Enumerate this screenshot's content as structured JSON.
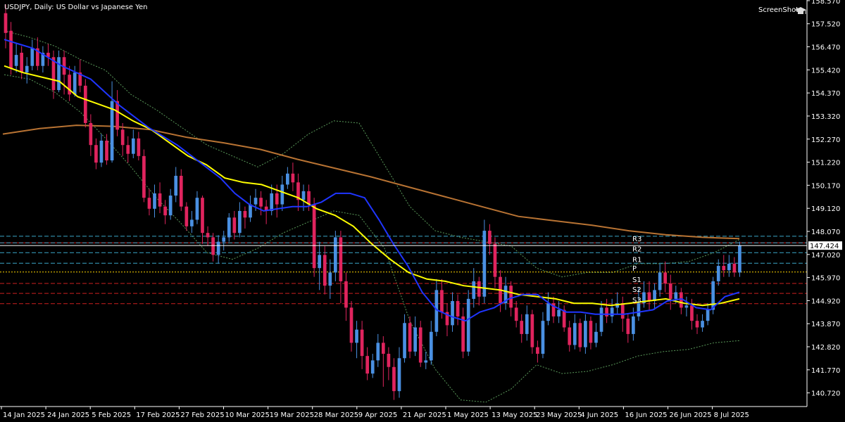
{
  "app": {
    "title": "USDJPY, Daily:  US Dollar vs Japanese Yen",
    "screenshot_label": "ScreenShot",
    "screenshot_icon": "graduation-cap-icon"
  },
  "colors": {
    "background": "#000000",
    "bull": "#4a90e2",
    "bear": "#e0245e",
    "ma_fast": "#1f35ff",
    "ma_slow": "#ffff00",
    "ma_long": "#b87333",
    "bands": "#5a9a5a",
    "axis": "#ffffff",
    "r_lines": "#3aa6c8",
    "p_line": "#ffd700",
    "s_lines": "#cc1f1f",
    "current": "#ffffff"
  },
  "chart_data": {
    "type": "candlestick",
    "symbol": "USDJPY",
    "timeframe": "Daily",
    "ylim": [
      140.1,
      158.6
    ],
    "y_ticks": [
      "158.570",
      "157.520",
      "156.470",
      "155.420",
      "154.370",
      "153.320",
      "152.270",
      "151.220",
      "150.170",
      "149.120",
      "148.070",
      "147.020",
      "145.970",
      "144.920",
      "143.870",
      "142.820",
      "141.770",
      "140.720"
    ],
    "x_ticks": [
      "14 Jan 2025",
      "24 Jan 2025",
      "5 Feb 2025",
      "17 Feb 2025",
      "27 Feb 2025",
      "10 Mar 2025",
      "19 Mar 2025",
      "28 Mar 2025",
      "9 Apr 2025",
      "21 Apr 2025",
      "1 May 2025",
      "13 May 2025",
      "23 May 2025",
      "4 Jun 2025",
      "16 Jun 2025",
      "26 Jun 2025",
      "8 Jul 2025"
    ],
    "current_price": "147.424",
    "pivot_levels": [
      {
        "name": "R3",
        "value": 147.55
      },
      {
        "name": "R2",
        "value": 147.1
      },
      {
        "name": "R1",
        "value": 146.62
      },
      {
        "name": "P",
        "value": 146.22
      },
      {
        "name": "S1",
        "value": 145.7
      },
      {
        "name": "S2",
        "value": 145.25
      },
      {
        "name": "S3",
        "value": 144.78
      }
    ],
    "extra_lines": [
      {
        "style": "dash-cyan",
        "value": 147.85
      },
      {
        "style": "solid-red",
        "value": 147.55
      }
    ],
    "candles": [
      [
        158.0,
        157.1,
        158.4,
        156.4
      ],
      [
        157.2,
        155.5,
        157.6,
        155.2
      ],
      [
        155.6,
        156.1,
        156.6,
        155.3
      ],
      [
        156.2,
        155.3,
        156.5,
        155.0
      ],
      [
        155.3,
        155.6,
        156.0,
        154.8
      ],
      [
        155.6,
        156.4,
        156.8,
        155.4
      ],
      [
        156.4,
        155.6,
        156.9,
        155.4
      ],
      [
        155.6,
        156.2,
        156.5,
        155.3
      ],
      [
        156.2,
        156.0,
        156.6,
        155.6
      ],
      [
        156.0,
        154.5,
        156.3,
        154.1
      ],
      [
        154.5,
        156.0,
        156.3,
        154.4
      ],
      [
        156.0,
        155.2,
        156.3,
        154.3
      ],
      [
        155.2,
        154.3,
        155.6,
        154.0
      ],
      [
        154.3,
        155.3,
        155.6,
        154.2
      ],
      [
        155.3,
        154.7,
        155.9,
        154.4
      ],
      [
        154.7,
        153.0,
        155.0,
        152.8
      ],
      [
        153.0,
        152.0,
        153.4,
        151.5
      ],
      [
        152.0,
        151.2,
        152.3,
        150.9
      ],
      [
        151.2,
        152.2,
        152.5,
        151.0
      ],
      [
        152.2,
        151.3,
        152.5,
        151.1
      ],
      [
        151.3,
        154.0,
        154.9,
        151.2
      ],
      [
        154.0,
        152.7,
        154.5,
        152.4
      ],
      [
        152.7,
        152.0,
        153.0,
        151.5
      ],
      [
        152.0,
        151.6,
        152.4,
        151.2
      ],
      [
        151.6,
        152.3,
        152.7,
        151.4
      ],
      [
        152.3,
        151.5,
        152.6,
        151.3
      ],
      [
        151.5,
        149.6,
        151.8,
        149.4
      ],
      [
        149.6,
        149.1,
        150.0,
        148.8
      ],
      [
        149.1,
        149.8,
        150.2,
        148.7
      ],
      [
        149.8,
        149.2,
        150.3,
        148.9
      ],
      [
        149.2,
        148.8,
        149.5,
        148.4
      ],
      [
        148.8,
        149.7,
        150.0,
        148.6
      ],
      [
        149.7,
        150.6,
        151.0,
        149.4
      ],
      [
        150.6,
        149.2,
        150.9,
        149.0
      ],
      [
        149.2,
        148.3,
        149.4,
        148.1
      ],
      [
        148.3,
        148.6,
        149.0,
        148.0
      ],
      [
        148.6,
        149.6,
        149.9,
        148.4
      ],
      [
        149.6,
        148.0,
        149.7,
        147.5
      ],
      [
        148.0,
        147.8,
        148.3,
        147.4
      ],
      [
        147.8,
        147.0,
        148.0,
        146.7
      ],
      [
        147.0,
        147.6,
        147.9,
        146.6
      ],
      [
        147.6,
        147.8,
        148.1,
        147.2
      ],
      [
        147.8,
        148.7,
        148.9,
        147.6
      ],
      [
        148.7,
        148.0,
        149.0,
        147.7
      ],
      [
        148.0,
        149.0,
        149.4,
        147.8
      ],
      [
        149.0,
        148.7,
        149.2,
        148.2
      ],
      [
        148.7,
        149.3,
        149.7,
        148.5
      ],
      [
        149.3,
        149.6,
        150.0,
        149.0
      ],
      [
        149.6,
        149.2,
        149.9,
        148.8
      ],
      [
        149.2,
        149.0,
        149.5,
        148.4
      ],
      [
        149.0,
        149.8,
        150.2,
        148.8
      ],
      [
        149.8,
        149.3,
        150.2,
        148.7
      ],
      [
        149.3,
        150.2,
        150.6,
        149.0
      ],
      [
        150.2,
        150.7,
        151.0,
        150.0
      ],
      [
        150.7,
        150.3,
        151.2,
        149.9
      ],
      [
        150.3,
        149.5,
        150.7,
        149.0
      ],
      [
        149.5,
        149.9,
        150.2,
        149.0
      ],
      [
        149.9,
        149.3,
        150.2,
        149.0
      ],
      [
        149.3,
        146.4,
        149.6,
        146.0
      ],
      [
        146.4,
        147.0,
        147.6,
        145.4
      ],
      [
        147.0,
        145.6,
        147.4,
        145.2
      ],
      [
        145.6,
        146.2,
        146.8,
        145.0
      ],
      [
        146.2,
        147.8,
        148.1,
        145.8
      ],
      [
        147.8,
        145.8,
        148.1,
        144.8
      ],
      [
        145.8,
        144.6,
        146.2,
        144.0
      ],
      [
        144.6,
        143.0,
        144.9,
        142.6
      ],
      [
        143.0,
        143.6,
        144.0,
        142.3
      ],
      [
        143.6,
        142.4,
        144.0,
        141.8
      ],
      [
        142.4,
        141.6,
        142.8,
        141.3
      ],
      [
        141.6,
        142.2,
        142.5,
        141.4
      ],
      [
        142.2,
        143.0,
        143.4,
        141.9
      ],
      [
        143.0,
        142.5,
        143.3,
        141.0
      ],
      [
        142.5,
        141.9,
        142.8,
        141.3
      ],
      [
        141.9,
        140.8,
        142.3,
        140.4
      ],
      [
        140.8,
        142.3,
        142.8,
        140.5
      ],
      [
        142.3,
        143.9,
        144.3,
        142.1
      ],
      [
        143.9,
        142.6,
        144.2,
        142.3
      ],
      [
        142.6,
        143.7,
        144.2,
        142.4
      ],
      [
        143.7,
        142.1,
        144.0,
        141.9
      ],
      [
        142.1,
        142.2,
        142.6,
        141.8
      ],
      [
        142.2,
        143.5,
        144.0,
        142.0
      ],
      [
        143.5,
        145.4,
        145.9,
        143.3
      ],
      [
        145.4,
        144.4,
        145.9,
        144.1
      ],
      [
        144.4,
        143.8,
        144.8,
        143.3
      ],
      [
        143.8,
        144.9,
        145.3,
        143.5
      ],
      [
        144.9,
        144.2,
        145.2,
        143.8
      ],
      [
        144.2,
        142.6,
        144.6,
        142.3
      ],
      [
        142.6,
        145.0,
        145.4,
        142.4
      ],
      [
        145.0,
        145.8,
        146.4,
        144.6
      ],
      [
        145.8,
        145.1,
        146.0,
        144.7
      ],
      [
        145.1,
        148.1,
        148.6,
        144.8
      ],
      [
        148.1,
        147.5,
        148.4,
        147.0
      ],
      [
        147.5,
        146.0,
        147.8,
        145.5
      ],
      [
        146.0,
        144.8,
        146.3,
        144.4
      ],
      [
        144.8,
        145.6,
        146.0,
        144.5
      ],
      [
        145.6,
        144.6,
        145.8,
        144.2
      ],
      [
        144.6,
        144.0,
        144.9,
        143.7
      ],
      [
        144.0,
        143.4,
        144.3,
        143.0
      ],
      [
        143.4,
        144.3,
        144.7,
        143.1
      ],
      [
        144.3,
        142.8,
        144.5,
        142.5
      ],
      [
        142.8,
        142.5,
        143.1,
        142.1
      ],
      [
        142.5,
        144.0,
        144.4,
        142.3
      ],
      [
        144.0,
        144.8,
        145.3,
        143.8
      ],
      [
        144.8,
        144.2,
        145.1,
        143.9
      ],
      [
        144.2,
        144.5,
        144.9,
        143.9
      ],
      [
        144.5,
        143.7,
        144.7,
        143.5
      ],
      [
        143.7,
        142.9,
        144.0,
        142.6
      ],
      [
        142.9,
        143.9,
        144.3,
        142.7
      ],
      [
        143.9,
        142.8,
        144.1,
        142.6
      ],
      [
        142.8,
        144.0,
        144.3,
        142.5
      ],
      [
        144.0,
        143.0,
        144.2,
        142.7
      ],
      [
        143.0,
        143.5,
        143.9,
        142.8
      ],
      [
        143.5,
        144.6,
        144.9,
        143.3
      ],
      [
        144.6,
        144.2,
        145.0,
        143.9
      ],
      [
        144.2,
        144.6,
        145.0,
        143.9
      ],
      [
        144.6,
        144.8,
        145.3,
        144.3
      ],
      [
        144.8,
        144.1,
        145.1,
        143.5
      ],
      [
        144.1,
        143.4,
        144.3,
        143.0
      ],
      [
        143.4,
        144.2,
        144.6,
        143.1
      ],
      [
        144.2,
        144.8,
        145.5,
        144.0
      ],
      [
        144.8,
        145.3,
        145.8,
        144.6
      ],
      [
        145.3,
        144.9,
        145.8,
        144.5
      ],
      [
        144.9,
        145.4,
        145.7,
        144.5
      ],
      [
        145.4,
        146.2,
        146.6,
        145.1
      ],
      [
        146.2,
        145.7,
        146.7,
        145.3
      ],
      [
        145.7,
        145.0,
        146.1,
        144.5
      ],
      [
        145.0,
        145.3,
        145.6,
        144.8
      ],
      [
        145.3,
        144.6,
        145.5,
        144.3
      ],
      [
        144.6,
        144.7,
        145.1,
        144.2
      ],
      [
        144.7,
        144.0,
        145.0,
        143.6
      ],
      [
        144.0,
        143.7,
        144.3,
        143.4
      ],
      [
        143.7,
        144.0,
        144.3,
        143.5
      ],
      [
        144.0,
        144.5,
        144.8,
        143.8
      ],
      [
        144.5,
        145.8,
        146.0,
        144.3
      ],
      [
        145.8,
        146.5,
        146.8,
        145.6
      ],
      [
        146.5,
        146.3,
        147.0,
        146.0
      ],
      [
        146.3,
        146.6,
        147.0,
        146.0
      ],
      [
        146.6,
        146.2,
        146.9,
        146.0
      ],
      [
        146.2,
        147.42,
        147.6,
        146.0
      ]
    ],
    "ma_fast": [
      156.8,
      156.6,
      156.4,
      156.0,
      155.6,
      155.3,
      155.0,
      154.4,
      153.8,
      153.3,
      152.8,
      152.4,
      152.0,
      151.5,
      151.0,
      150.5,
      149.8,
      149.3,
      149.0,
      149.1,
      149.2,
      149.2,
      149.4,
      149.8,
      149.8,
      149.6,
      148.6,
      147.5,
      146.5,
      145.3,
      144.5,
      144.2,
      144.0,
      144.4,
      144.6,
      145.0,
      145.2,
      145.2,
      144.7,
      144.4,
      144.4,
      144.3,
      144.3,
      144.3,
      144.4,
      144.5,
      144.9,
      145.0,
      144.6,
      144.5,
      145.1,
      145.3
    ],
    "ma_slow": [
      155.6,
      155.3,
      155.1,
      154.9,
      154.2,
      153.9,
      153.6,
      153.1,
      152.7,
      152.1,
      151.5,
      151.1,
      150.5,
      150.3,
      150.2,
      149.9,
      149.6,
      149.1,
      148.8,
      148.3,
      147.5,
      146.8,
      146.2,
      145.9,
      145.8,
      145.6,
      145.5,
      145.4,
      145.2,
      145.1,
      145.0,
      144.8,
      144.8,
      144.7,
      144.8,
      144.9,
      145.0,
      144.8,
      144.7,
      144.8,
      145.0
    ],
    "ma_long": [
      152.5,
      152.75,
      152.9,
      152.85,
      152.7,
      152.35,
      152.1,
      151.8,
      151.35,
      150.95,
      150.55,
      150.1,
      149.65,
      149.2,
      148.75,
      148.55,
      148.35,
      148.1,
      147.92,
      147.8,
      147.74
    ],
    "bands_upper": [
      157.2,
      156.9,
      156.5,
      155.9,
      155.4,
      154.3,
      153.6,
      152.8,
      152.0,
      151.5,
      151.0,
      151.6,
      152.5,
      153.1,
      153.0,
      151.1,
      149.2,
      148.1,
      147.8,
      147.6,
      147.4,
      146.4,
      146.0,
      146.2,
      146.2,
      146.6,
      146.6,
      146.7,
      147.1,
      147.7
    ],
    "bands_lower": [
      155.2,
      155.0,
      154.4,
      153.5,
      152.3,
      151.0,
      149.6,
      148.4,
      147.1,
      146.8,
      147.3,
      148.0,
      148.5,
      149.0,
      148.8,
      147.3,
      144.0,
      141.8,
      140.4,
      140.3,
      140.9,
      142.0,
      141.6,
      141.7,
      142.0,
      142.4,
      142.6,
      142.7,
      143.0,
      143.1
    ]
  }
}
